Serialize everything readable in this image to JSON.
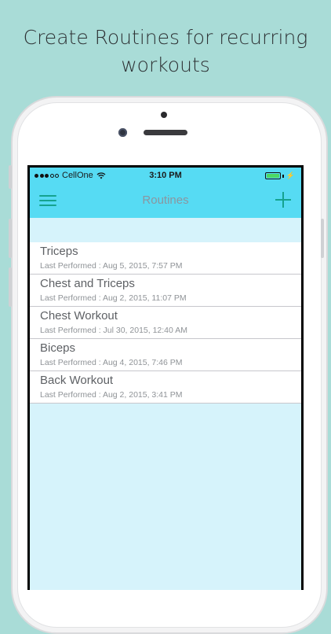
{
  "promo": {
    "line1": "Create Routines for recurring",
    "line2": "workouts"
  },
  "status_bar": {
    "carrier": "CellOne",
    "time": "3:10 PM"
  },
  "nav": {
    "title": "Routines",
    "left_icon": "hamburger-menu-icon",
    "right_icon": "plus-icon"
  },
  "routines": [
    {
      "name": "Triceps",
      "last_performed": "Last Performed : Aug 5, 2015, 7:57 PM"
    },
    {
      "name": "Chest and Triceps",
      "last_performed": "Last Performed : Aug 2, 2015, 11:07 PM"
    },
    {
      "name": "Chest Workout",
      "last_performed": "Last Performed : Jul 30, 2015, 12:40 AM"
    },
    {
      "name": "Biceps",
      "last_performed": "Last Performed : Aug 4, 2015, 7:46 PM"
    },
    {
      "name": "Back Workout",
      "last_performed": "Last Performed : Aug 2, 2015, 3:41 PM"
    }
  ],
  "colors": {
    "background": "#a9dcd7",
    "navbar": "#56dbf3",
    "accent": "#15a38f",
    "list_bg": "#d6f3fb"
  }
}
